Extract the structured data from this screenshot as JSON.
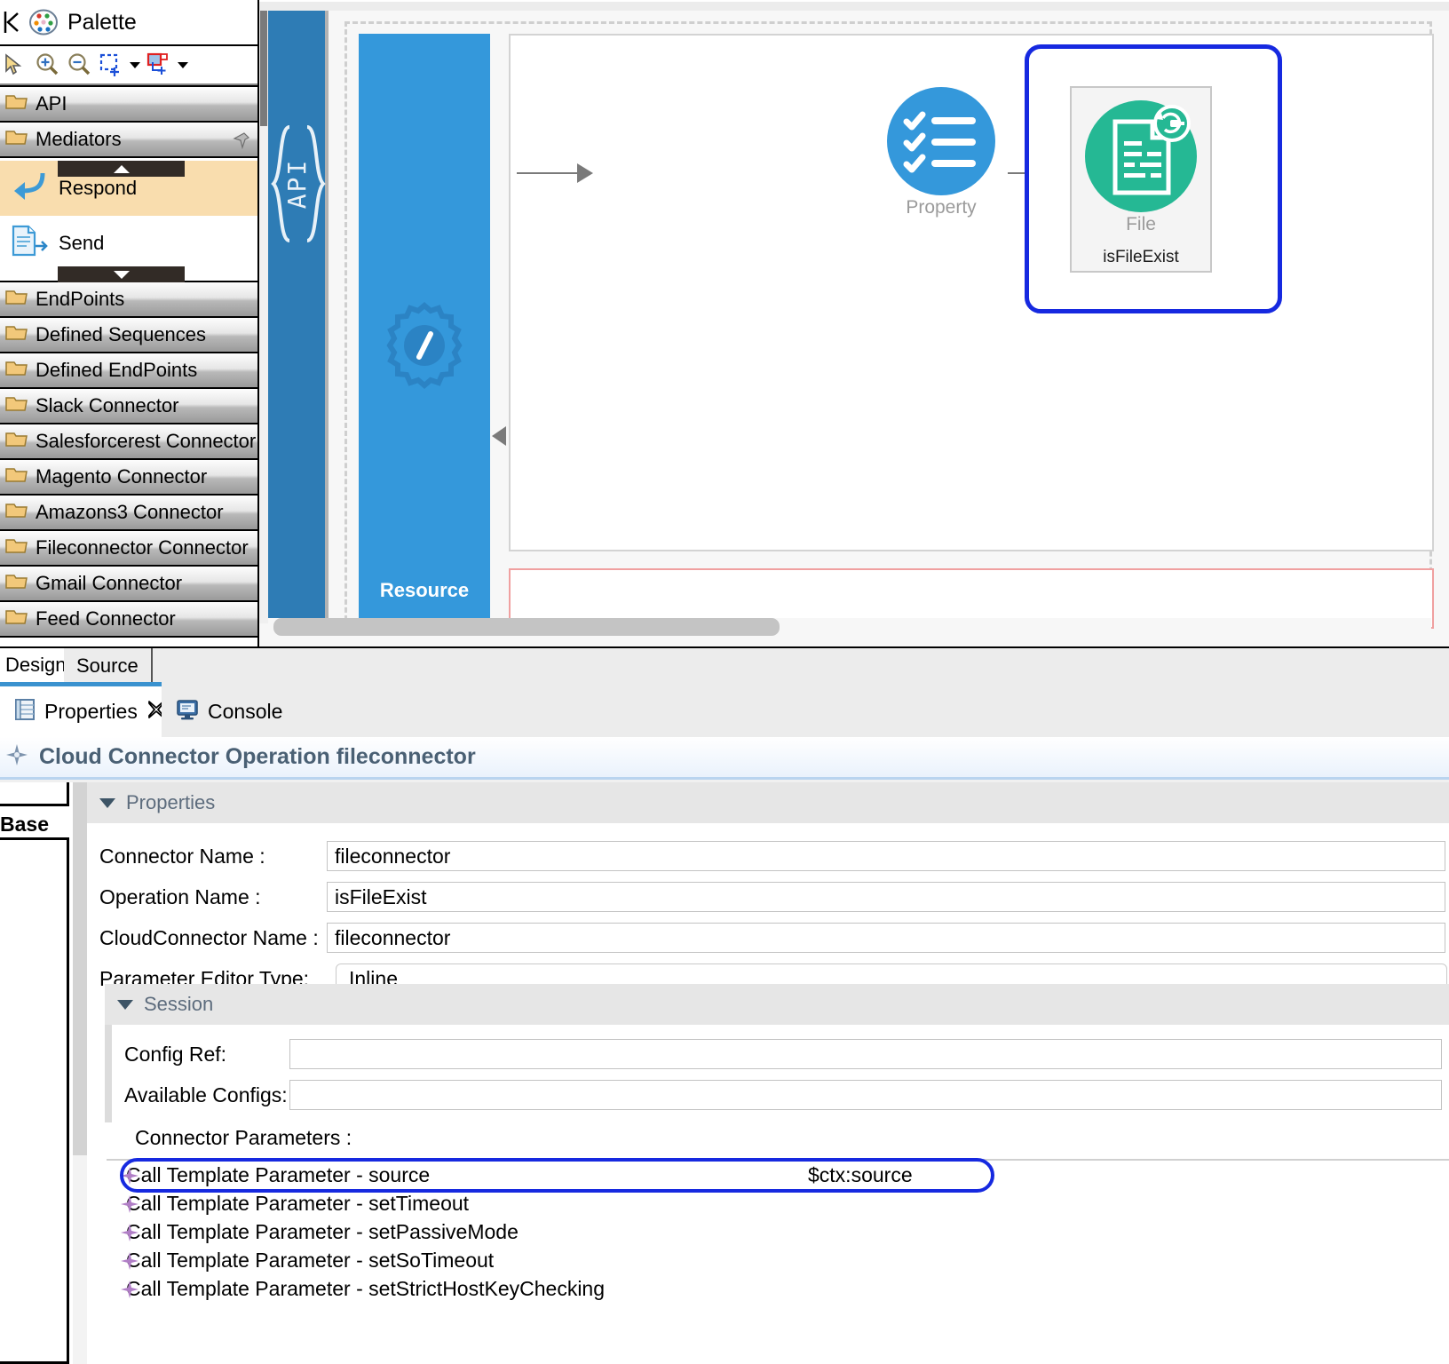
{
  "palette": {
    "title": "Palette",
    "icons": {
      "collapse": "collapse-left-icon",
      "logo": "palette-logo-icon"
    },
    "toolbar": [
      {
        "name": "select-tool-icon",
        "label": "Select"
      },
      {
        "name": "zoom-in-icon",
        "label": "Zoom In"
      },
      {
        "name": "zoom-out-icon",
        "label": "Zoom Out"
      },
      {
        "name": "marquee-select-icon",
        "label": "Marquee"
      },
      {
        "name": "marquee-dropdown-caret",
        "label": "Marquee options"
      },
      {
        "name": "note-attachment-icon",
        "label": "Note"
      },
      {
        "name": "note-dropdown-caret",
        "label": "Note options"
      }
    ],
    "groups": [
      {
        "label": "API",
        "pinned": false
      },
      {
        "label": "Mediators",
        "pinned": true
      }
    ],
    "mediators": [
      {
        "label": "Respond",
        "icon": "respond-icon",
        "selected": true
      },
      {
        "label": "Send",
        "icon": "send-icon",
        "selected": false
      }
    ],
    "drawers": [
      "EndPoints",
      "Defined Sequences",
      "Defined EndPoints",
      "Slack Connector",
      "Salesforcerest Connector",
      "Magento Connector",
      "Amazons3 Connector",
      "Fileconnector Connector",
      "Gmail Connector",
      "Feed Connector"
    ]
  },
  "canvas": {
    "api_band_label": "{API}",
    "resource_label": "Resource",
    "nodes": [
      {
        "caption": "Property",
        "sub": "",
        "icon": "checklist-icon",
        "color": "#3498db"
      },
      {
        "caption": "File",
        "sub": "isFileExist",
        "icon": "file-connector-icon",
        "color": "#25b894",
        "selected": true
      }
    ],
    "selection_color": "#1629e0"
  },
  "editor_tabs": [
    {
      "label": "Design",
      "active": true
    },
    {
      "label": "Source",
      "active": false
    }
  ],
  "view_tabs": [
    {
      "label": "Properties",
      "icon": "properties-icon",
      "active": true,
      "close_icon": "close-x-icon"
    },
    {
      "label": "Console",
      "icon": "console-icon",
      "active": false
    }
  ],
  "properties_view": {
    "title": "Cloud Connector Operation fileconnector",
    "title_icon": "diamond-icon",
    "tree": {
      "base_label": "Base"
    },
    "section_properties_label": "Properties",
    "fields": [
      {
        "label": "Connector Name :",
        "value": "fileconnector",
        "rounded": false
      },
      {
        "label": "Operation Name :",
        "value": "isFileExist",
        "rounded": false
      },
      {
        "label": "CloudConnector Name :",
        "value": "fileconnector",
        "rounded": false
      },
      {
        "label": "Parameter Editor Type:",
        "value": "Inline",
        "rounded": true
      }
    ],
    "session": {
      "label": "Session",
      "fields": [
        {
          "label": "Config Ref:",
          "value": ""
        },
        {
          "label": "Available Configs:",
          "value": ""
        }
      ]
    },
    "connector_parameters_label": "Connector Parameters :",
    "parameters": [
      {
        "name": "Call Template Parameter  -  source",
        "value": "$ctx:source",
        "selected": true
      },
      {
        "name": "Call Template Parameter  -  setTimeout",
        "value": "",
        "selected": false
      },
      {
        "name": "Call Template Parameter  -  setPassiveMode",
        "value": "",
        "selected": false
      },
      {
        "name": "Call Template Parameter  -  setSoTimeout",
        "value": "",
        "selected": false
      },
      {
        "name": "Call Template Parameter  -  setStrictHostKeyChecking",
        "value": "",
        "selected": false
      }
    ]
  },
  "colors": {
    "api_band": "#2e7cb5",
    "resource_band": "#3498db",
    "file_node": "#25b894",
    "selection": "#1629e0",
    "tab_accent": "#3a92cf",
    "title_text": "#4a6074"
  }
}
